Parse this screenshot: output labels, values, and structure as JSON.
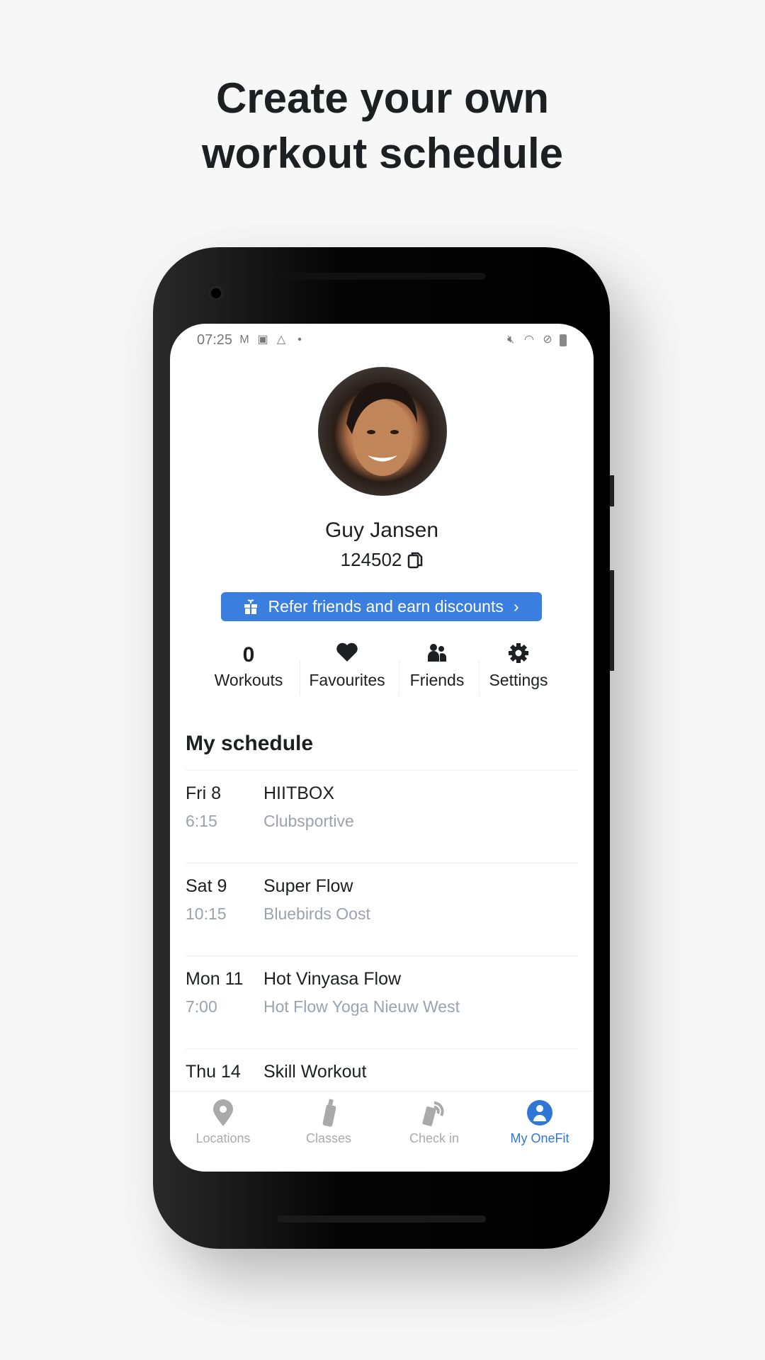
{
  "headline": {
    "line1": "Create your own",
    "line2": "workout schedule"
  },
  "status_bar": {
    "time": "07:25",
    "left_icons": [
      "gmail-icon",
      "gallery-icon",
      "drive-icon",
      "dot-icon"
    ],
    "right_icons": [
      "mute-icon",
      "wifi-icon",
      "do-not-disturb-icon",
      "battery-icon"
    ]
  },
  "profile": {
    "name": "Guy Jansen",
    "member_id": "124502"
  },
  "refer": {
    "label": "Refer friends and earn discounts",
    "color": "#3a7fe0"
  },
  "stats": [
    {
      "value": "0",
      "label": "Workouts"
    },
    {
      "icon": "heart-icon",
      "label": "Favourites"
    },
    {
      "icon": "friends-icon",
      "label": "Friends"
    },
    {
      "icon": "gear-icon",
      "label": "Settings"
    }
  ],
  "schedule": {
    "title": "My schedule",
    "items": [
      {
        "day": "Fri 8",
        "time": "6:15",
        "class": "HIITBOX",
        "location": "Clubsportive"
      },
      {
        "day": "Sat 9",
        "time": "10:15",
        "class": "Super Flow",
        "location": "Bluebirds Oost"
      },
      {
        "day": "Mon 11",
        "time": "7:00",
        "class": "Hot Vinyasa Flow",
        "location": "Hot Flow Yoga Nieuw West"
      },
      {
        "day": "Thu 14",
        "time": "",
        "class": "Skill Workout",
        "location": ""
      }
    ]
  },
  "nav": {
    "items": [
      {
        "label": "Locations",
        "icon": "location-pin-icon"
      },
      {
        "label": "Classes",
        "icon": "bottle-icon"
      },
      {
        "label": "Check in",
        "icon": "phone-nfc-icon"
      },
      {
        "label": "My OneFit",
        "icon": "user-icon",
        "active": true
      }
    ],
    "active_color": "#2f76d6"
  }
}
